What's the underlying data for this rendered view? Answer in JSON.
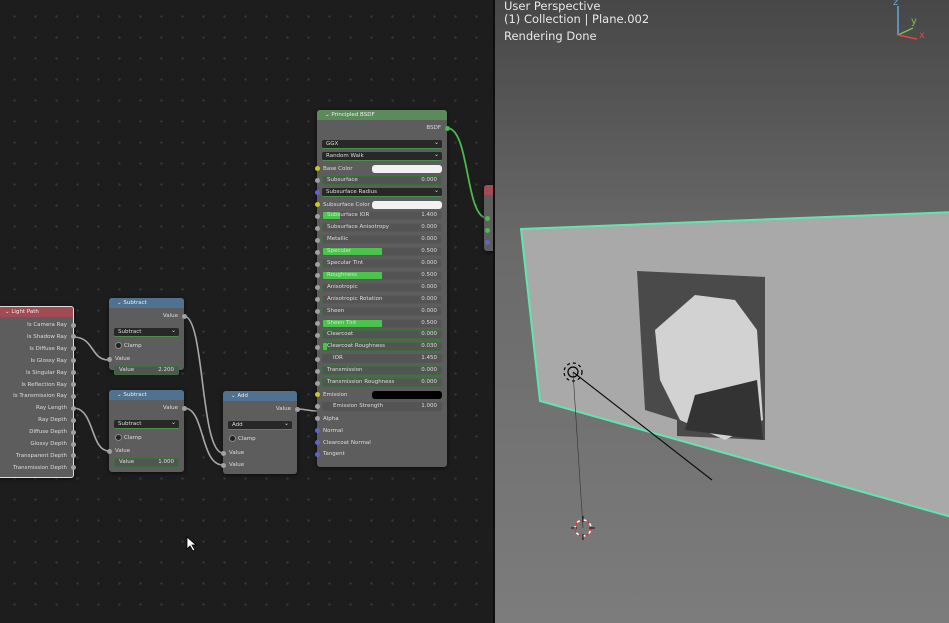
{
  "light_path": {
    "title": "Light Path",
    "outputs": [
      "Is Camera Ray",
      "Is Shadow Ray",
      "Is Diffuse Ray",
      "Is Glossy Ray",
      "Is Singular Ray",
      "Is Reflection Ray",
      "Is Transmission Ray",
      "Ray Length",
      "Ray Depth",
      "Diffuse Depth",
      "Glossy Depth",
      "Transparent Depth",
      "Transmission Depth"
    ]
  },
  "subtract1": {
    "title": "Subtract",
    "output": "Value",
    "operation": "Subtract",
    "clamp": "Clamp",
    "input": "Value",
    "field_label": "Value",
    "field_value": "2.200"
  },
  "subtract2": {
    "title": "Subtract",
    "output": "Value",
    "operation": "Subtract",
    "clamp": "Clamp",
    "input": "Value",
    "field_label": "Value",
    "field_value": "1.000"
  },
  "add": {
    "title": "Add",
    "output": "Value",
    "operation": "Add",
    "clamp": "Clamp",
    "input1": "Value",
    "input2": "Value"
  },
  "bsdf": {
    "title": "Principled BSDF",
    "output": "BSDF",
    "rows": [
      {
        "t": "dd",
        "label": "GGX"
      },
      {
        "t": "dd",
        "label": "Random Walk"
      },
      {
        "t": "color",
        "label": "Base Color",
        "color": "#f2f2f2",
        "sock": "#c7c729"
      },
      {
        "t": "sl",
        "label": "Subsurface",
        "value": "0.000",
        "fill": 0
      },
      {
        "t": "dd",
        "label": "Subsurface Radius",
        "sock": "#6363c7"
      },
      {
        "t": "color",
        "label": "Subsurface Color",
        "color": "#f2f2f2",
        "sock": "#c7c729"
      },
      {
        "t": "sl",
        "label": "Subsurface IOR",
        "value": "1.400",
        "fill": 0.14
      },
      {
        "t": "sl",
        "label": "Subsurface Anisotropy",
        "value": "0.000",
        "fill": 0
      },
      {
        "t": "sl",
        "label": "Metallic",
        "value": "0.000",
        "fill": 0
      },
      {
        "t": "sl",
        "label": "Specular",
        "value": "0.500",
        "fill": 0.5
      },
      {
        "t": "sl",
        "label": "Specular Tint",
        "value": "0.000",
        "fill": 0
      },
      {
        "t": "sl",
        "label": "Roughness",
        "value": "0.500",
        "fill": 0.5
      },
      {
        "t": "sl",
        "label": "Anisotropic",
        "value": "0.000",
        "fill": 0
      },
      {
        "t": "sl",
        "label": "Anisotropic Rotation",
        "value": "0.000",
        "fill": 0
      },
      {
        "t": "sl",
        "label": "Sheen",
        "value": "0.000",
        "fill": 0
      },
      {
        "t": "sl",
        "label": "Sheen Tint",
        "value": "0.500",
        "fill": 0.5
      },
      {
        "t": "sl",
        "label": "Clearcoat",
        "value": "0.000",
        "fill": 0
      },
      {
        "t": "sl",
        "label": "Clearcoat Roughness",
        "value": "0.030",
        "fill": 0.03
      },
      {
        "t": "sl",
        "label": "IOR",
        "value": "1.450",
        "fill": 0,
        "plain": true
      },
      {
        "t": "sl",
        "label": "Transmission",
        "value": "0.000",
        "fill": 0
      },
      {
        "t": "sl",
        "label": "Transmission Roughness",
        "value": "0.000",
        "fill": 0
      },
      {
        "t": "color",
        "label": "Emission",
        "color": "#000000",
        "sock": "#c7c729"
      },
      {
        "t": "sl",
        "label": "Emission Strength",
        "value": "1.000",
        "fill": 0,
        "plain": true
      },
      {
        "t": "in",
        "label": "Alpha"
      },
      {
        "t": "in",
        "label": "Normal",
        "sock": "#6363c7"
      },
      {
        "t": "in",
        "label": "Clearcoat Normal",
        "sock": "#6363c7"
      },
      {
        "t": "in",
        "label": "Tangent",
        "sock": "#6363c7"
      }
    ]
  },
  "viewport": {
    "view": "User Perspective",
    "collection": "(1) Collection | Plane.002",
    "status": "Rendering Done",
    "axes": {
      "x": "x",
      "y": "y",
      "z": "z"
    }
  },
  "colors": {
    "header_input": "#a34a55",
    "header_converter": "#4e7290",
    "header_shader": "#5b8a5b",
    "wire_shader": "#4fb84f",
    "wire": "#a8a8a8",
    "selection": "#5fe6b0"
  }
}
